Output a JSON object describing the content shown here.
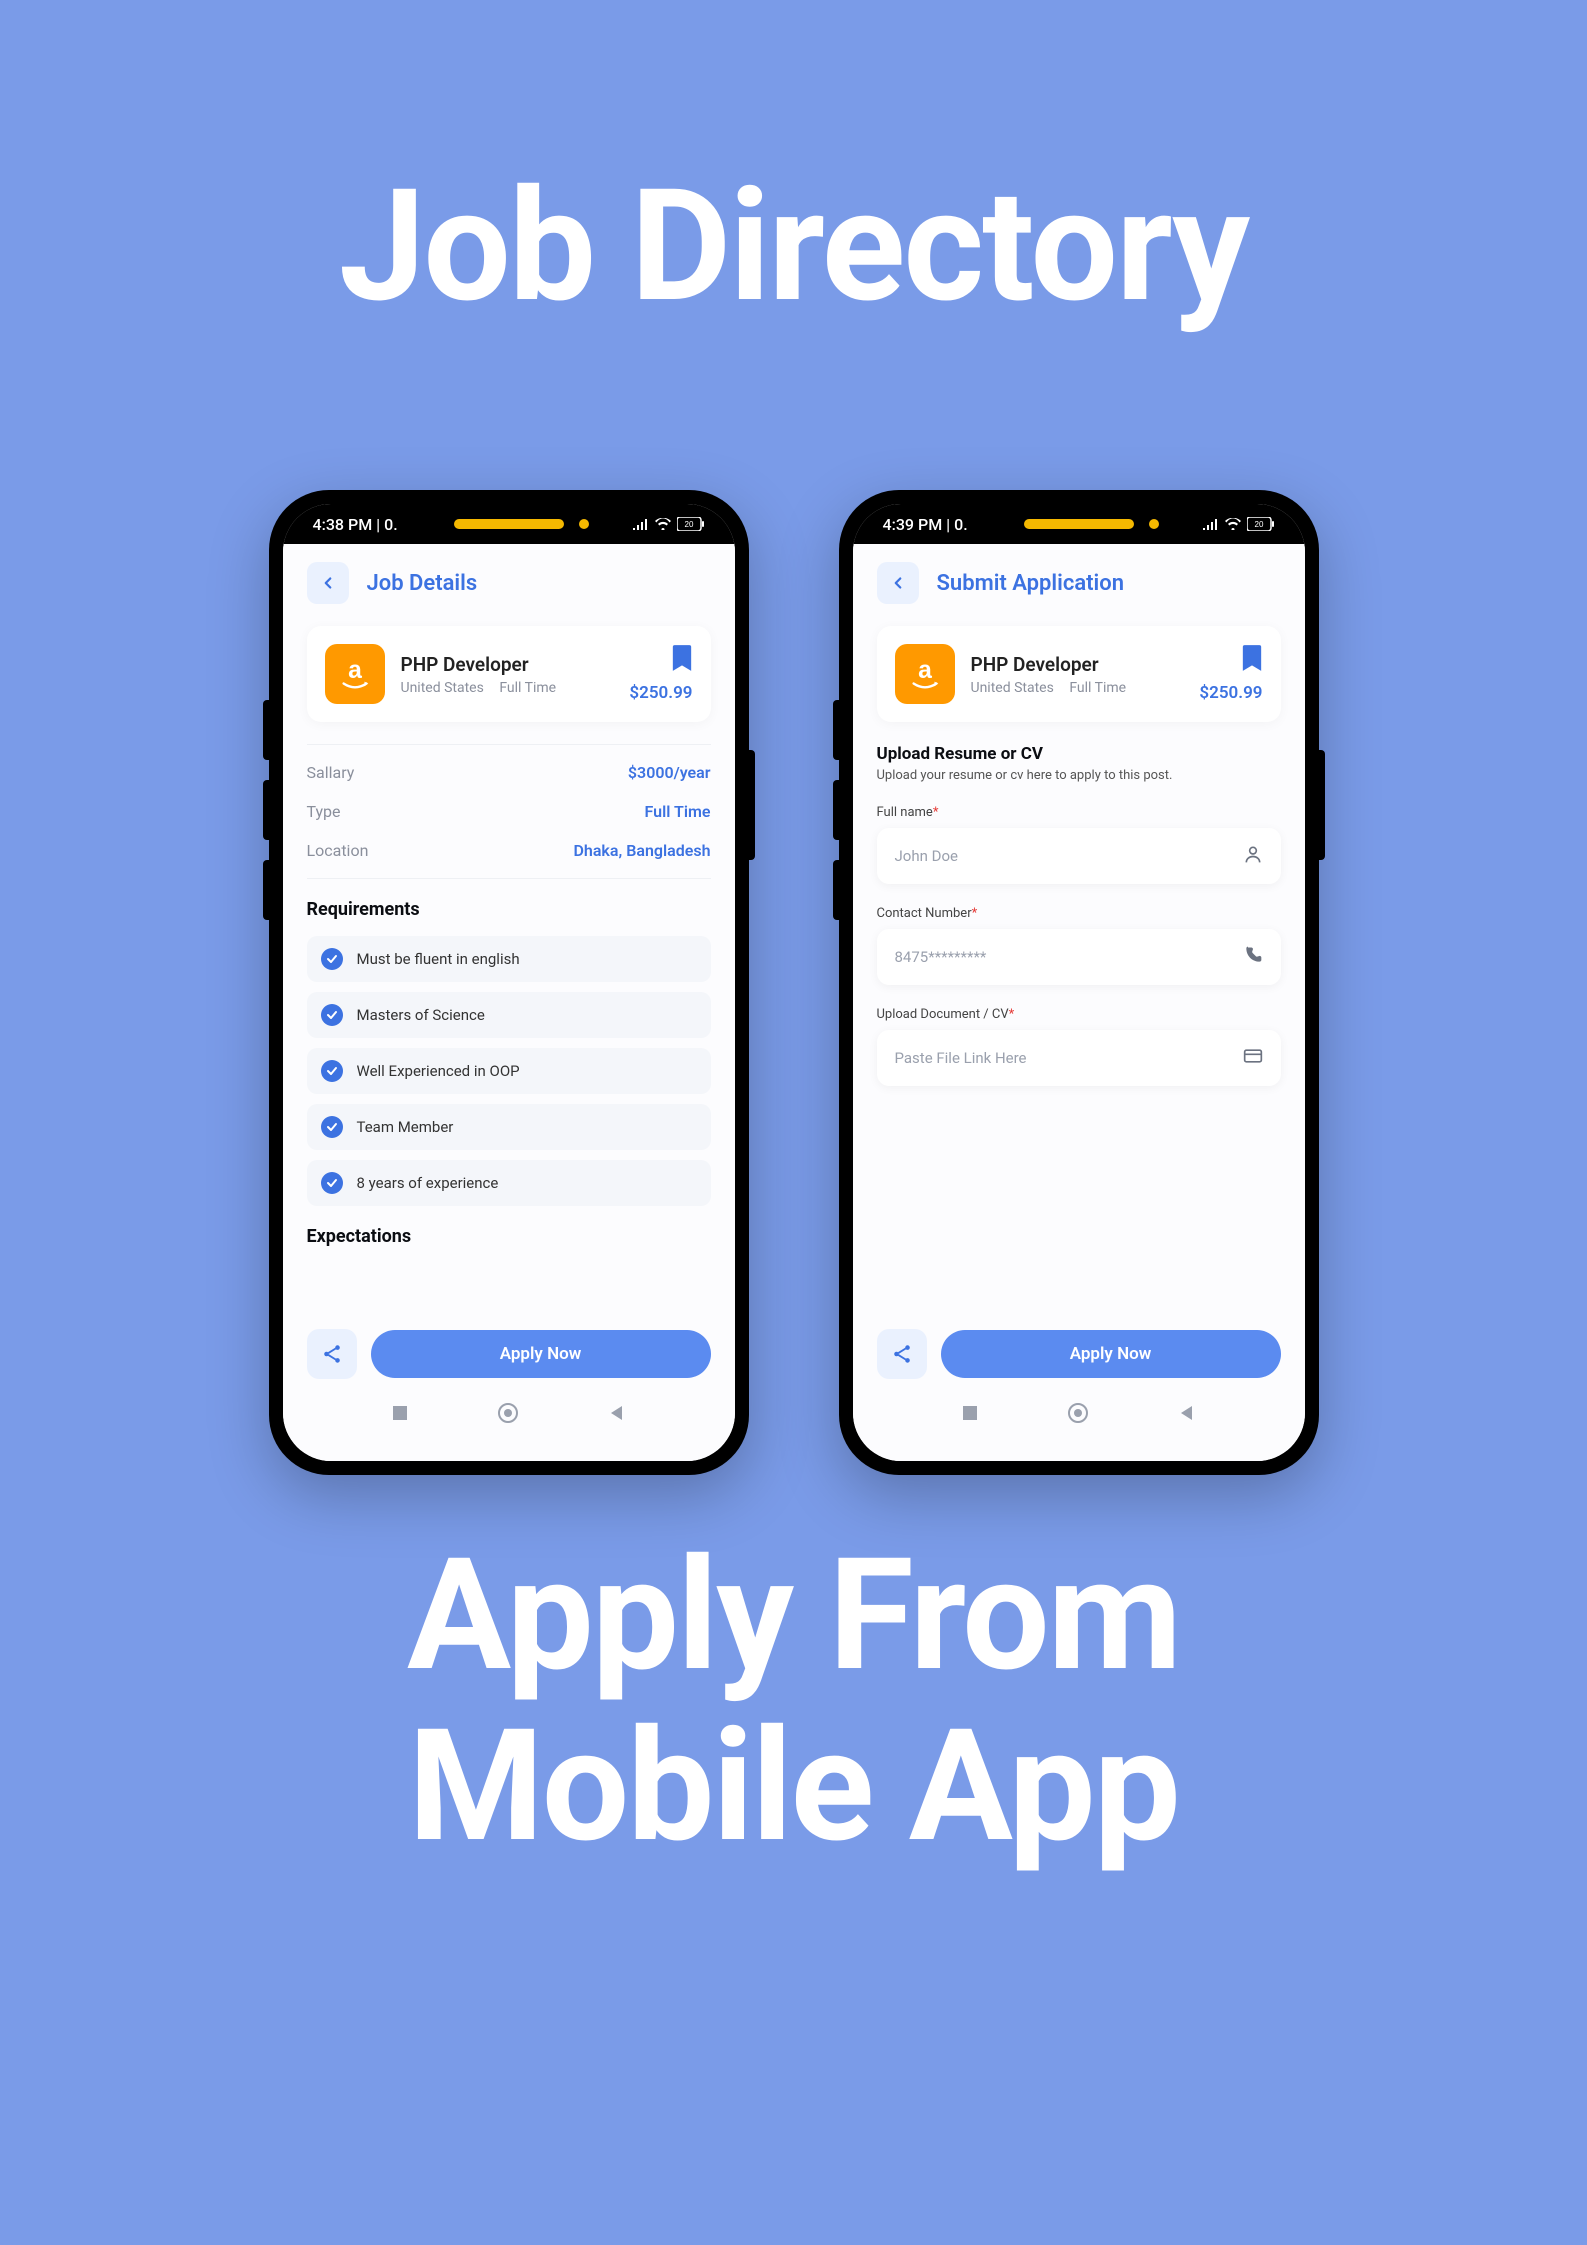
{
  "hero": {
    "title": "Job Directory",
    "subtitle_line1": "Apply From",
    "subtitle_line2": "Mobile App"
  },
  "phone1": {
    "status_time": "4:38 PM | 0.",
    "status_battery": "20",
    "header_title": "Job Details",
    "job": {
      "title": "PHP Developer",
      "location": "United States",
      "type": "Full Time",
      "price": "$250.99",
      "logo_name": "amazon-logo"
    },
    "details": [
      {
        "label": "Sallary",
        "value": "$3000/year"
      },
      {
        "label": "Type",
        "value": "Full Time"
      },
      {
        "label": "Location",
        "value": "Dhaka, Bangladesh"
      }
    ],
    "requirements_title": "Requirements",
    "requirements": [
      "Must be fluent in english",
      "Masters of Science",
      "Well Experienced in OOP",
      "Team Member",
      "8 years of experience"
    ],
    "expectations_title": "Expectations",
    "apply_label": "Apply Now"
  },
  "phone2": {
    "status_time": "4:39 PM | 0.",
    "status_battery": "20",
    "header_title": "Submit Application",
    "job": {
      "title": "PHP Developer",
      "location": "United States",
      "type": "Full Time",
      "price": "$250.99",
      "logo_name": "amazon-logo"
    },
    "upload_heading": "Upload Resume or CV",
    "upload_sub": "Upload your resume or cv here to apply to this post.",
    "fields": {
      "fullname_label": "Full name",
      "fullname_placeholder": "John Doe",
      "contact_label": "Contact Number",
      "contact_placeholder": "8475*********",
      "document_label": "Upload Document / CV",
      "document_placeholder": "Paste File Link Here"
    },
    "apply_label": "Apply Now"
  },
  "colors": {
    "bg": "#7a9be8",
    "primary": "#3c72e1",
    "accent": "#ff9900"
  }
}
